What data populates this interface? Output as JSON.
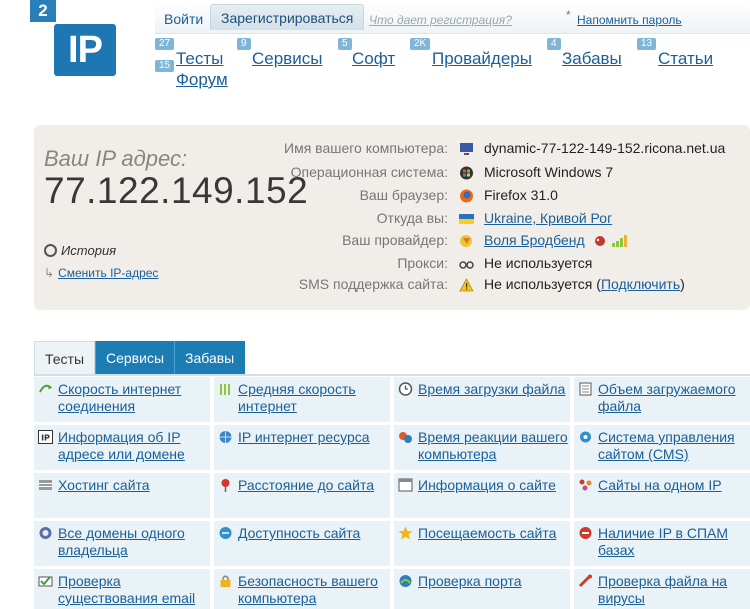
{
  "logo": {
    "badge": "2",
    "text": "IP"
  },
  "auth": {
    "login": "Войти",
    "register": "Зарегистрироваться",
    "why": "Что дает регистрация?",
    "remind_star": "*",
    "remind": "Напомнить пароль"
  },
  "nav": [
    {
      "count": "27",
      "label": "Тесты"
    },
    {
      "count": "9",
      "label": "Сервисы"
    },
    {
      "count": "5",
      "label": "Софт"
    },
    {
      "count": "2K",
      "label": "Провайдеры"
    },
    {
      "count": "4",
      "label": "Забавы"
    },
    {
      "count": "13",
      "label": "Статьи"
    },
    {
      "count": "15",
      "label": "Форум"
    }
  ],
  "ip_panel": {
    "label": "Ваш IP адрес:",
    "value": "77.122.149.152",
    "history": "История",
    "change": "Сменить IP-адрес"
  },
  "info": [
    {
      "key": "Имя вашего компьютера:",
      "icon": "computer-icon",
      "value": "dynamic-77-122-149-152.ricona.net.ua"
    },
    {
      "key": "Операционная система:",
      "icon": "windows-icon",
      "value": "Microsoft Windows 7"
    },
    {
      "key": "Ваш браузер:",
      "icon": "firefox-icon",
      "value": "Firefox 31.0"
    },
    {
      "key": "Откуда вы:",
      "icon": "ukraine-flag-icon",
      "value": "Ukraine, Кривой Рог"
    },
    {
      "key": "Ваш провайдер:",
      "icon": "provider-icon",
      "value": "Воля Бродбенд"
    },
    {
      "key": "Прокси:",
      "icon": "glasses-icon",
      "value": "Не используется"
    },
    {
      "key": "SMS поддержка сайта:",
      "icon": "warning-icon",
      "value_prefix": "Не используется (",
      "value_link": "Подключить",
      "value_suffix": ")"
    }
  ],
  "tabs": [
    "Тесты",
    "Сервисы",
    "Забавы"
  ],
  "grid": [
    {
      "icon": "speed-icon",
      "label": "Скорость интернет соединения"
    },
    {
      "icon": "bars-icon",
      "label": "Средняя скорость интернет"
    },
    {
      "icon": "clock-icon",
      "label": "Время загрузки файла"
    },
    {
      "icon": "page-icon",
      "label": "Объем загружаемого файла"
    },
    {
      "icon": "ip-icon",
      "label": "Информация об IP адресе или домене"
    },
    {
      "icon": "globe-ip-icon",
      "label": "IP интернет ресурса"
    },
    {
      "icon": "reaction-icon",
      "label": "Время реакции вашего компьютера"
    },
    {
      "icon": "cms-icon",
      "label": "Система управления сайтом (CMS)"
    },
    {
      "icon": "hosting-icon",
      "label": "Хостинг сайта"
    },
    {
      "icon": "pin-icon",
      "label": "Расстояние до сайта"
    },
    {
      "icon": "window-icon",
      "label": "Информация о сайте"
    },
    {
      "icon": "sites-icon",
      "label": "Сайты на одном IP"
    },
    {
      "icon": "owner-icon",
      "label": "Все домены одного владельца"
    },
    {
      "icon": "availability-icon",
      "label": "Доступность сайта"
    },
    {
      "icon": "star-icon",
      "label": "Посещаемость сайта"
    },
    {
      "icon": "spam-icon",
      "label": "Наличие IP в СПАМ базах"
    },
    {
      "icon": "email-check-icon",
      "label": "Проверка существования email"
    },
    {
      "icon": "lock-icon",
      "label": "Безопасность вашего компьютера"
    },
    {
      "icon": "port-icon",
      "label": "Проверка порта"
    },
    {
      "icon": "virus-icon",
      "label": "Проверка файла на вирусы"
    }
  ]
}
